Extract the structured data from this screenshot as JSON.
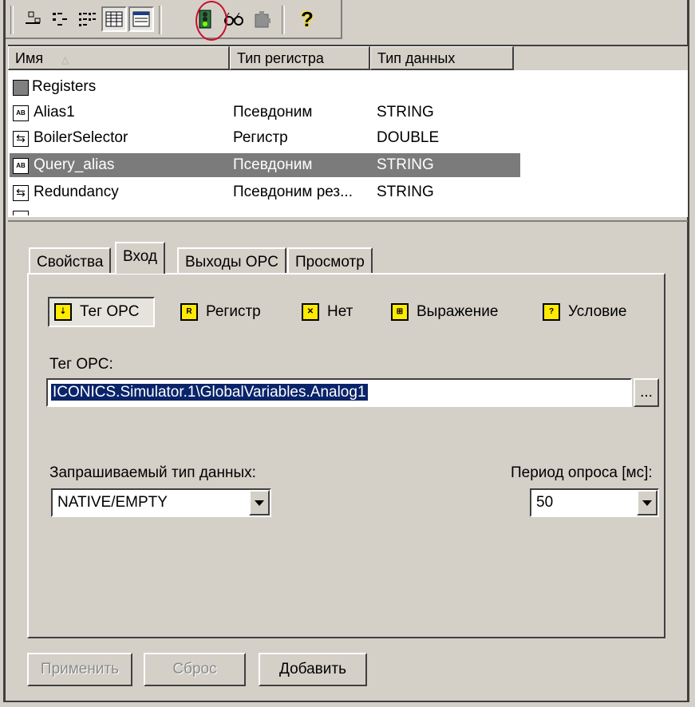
{
  "toolbar": {
    "buttons": [
      {
        "icon": "large-icons-view-icon"
      },
      {
        "icon": "small-icons-view-icon"
      },
      {
        "icon": "list-view-icon"
      },
      {
        "icon": "details-view-icon"
      },
      {
        "icon": "properties-view-icon"
      },
      {
        "icon": "traffic-light-icon"
      },
      {
        "icon": "glasses-icon"
      },
      {
        "icon": "puzzle-icon"
      },
      {
        "icon": "help-icon",
        "glyph": "?"
      }
    ]
  },
  "listview": {
    "columns": [
      "Имя",
      "Тип регистра",
      "Тип данных"
    ],
    "root": "Registers",
    "rows": [
      {
        "name": "Alias1",
        "type": "Псевдоним",
        "data_type": "STRING",
        "icon": "alias-icon",
        "icon_text": "AB"
      },
      {
        "name": "BoilerSelector",
        "type": "Регистр",
        "data_type": "DOUBLE",
        "icon": "register-icon",
        "icon_text": "⇆"
      },
      {
        "name": "Query_alias",
        "type": "Псевдоним",
        "data_type": "STRING",
        "icon": "alias-icon",
        "icon_text": "AB",
        "selected": true
      },
      {
        "name": "Redundancy",
        "type": "Псевдоним рез...",
        "data_type": "STRING",
        "icon": "register-icon",
        "icon_text": "⇆"
      }
    ]
  },
  "tabs": [
    "Свойства",
    "Вход",
    "Выходы OPC",
    "Просмотр"
  ],
  "input_modes": [
    {
      "label": "Тег OPC",
      "icon": "opc-tag-icon",
      "icon_text": "⇣"
    },
    {
      "label": "Регистр",
      "icon": "register-mode-icon",
      "icon_text": "R"
    },
    {
      "label": "Нет",
      "icon": "none-mode-icon",
      "icon_text": "✕"
    },
    {
      "label": "Выражение",
      "icon": "expression-icon",
      "icon_text": "⊞"
    },
    {
      "label": "Условие",
      "icon": "condition-icon",
      "icon_text": "?"
    }
  ],
  "opc_tag": {
    "label": "Тег OPC:",
    "value": "ICONICS.Simulator.1\\GlobalVariables.Analog1",
    "browse": "..."
  },
  "data_type": {
    "label": "Запрашиваемый тип данных:",
    "value": "NATIVE/EMPTY"
  },
  "poll_period": {
    "label": "Период опроса [мс]:",
    "value": "50"
  },
  "buttons": {
    "apply": "Применить",
    "reset": "Сброс",
    "add": "Добавить"
  },
  "colors": {
    "background": "#d4d0c8",
    "selection": "#7b7b7b",
    "text_selection": "#0a246a",
    "highlight_circle": "#c8102e"
  }
}
